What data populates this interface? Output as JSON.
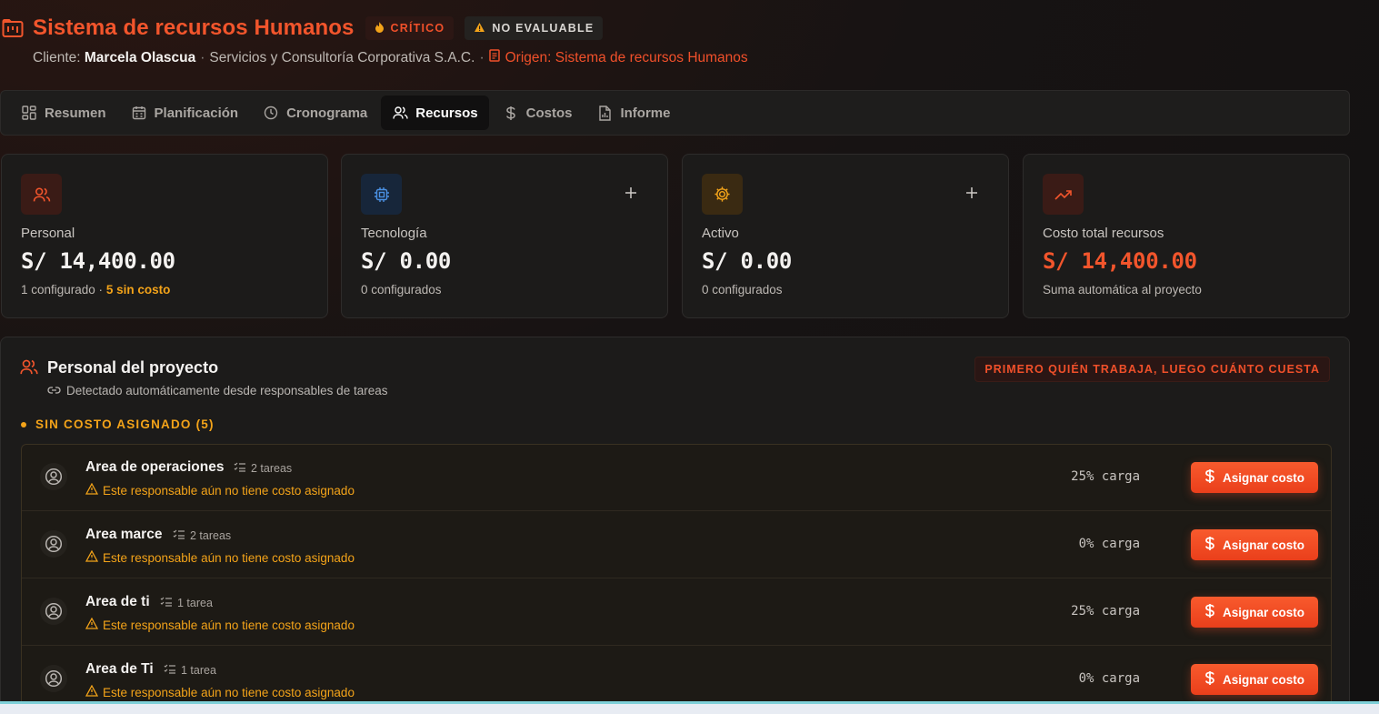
{
  "header": {
    "title": "Sistema de recursos Humanos",
    "badge_critical": "CRÍTICO",
    "badge_noeval": "NO EVALUABLE",
    "client_prefix": "Cliente:",
    "client_name": "Marcela Olascua",
    "company": "Servicios y Consultoría Corporativa S.A.C.",
    "origin": "Origen: Sistema de recursos Humanos"
  },
  "tabs": [
    {
      "label": "Resumen",
      "icon": "grid-icon"
    },
    {
      "label": "Planificación",
      "icon": "calendar-icon"
    },
    {
      "label": "Cronograma",
      "icon": "clock-icon"
    },
    {
      "label": "Recursos",
      "icon": "users-icon",
      "active": true
    },
    {
      "label": "Costos",
      "icon": "dollar-icon"
    },
    {
      "label": "Informe",
      "icon": "report-icon"
    }
  ],
  "cards": [
    {
      "label": "Personal",
      "value": "S/ 14,400.00",
      "note": "1 configurado ·",
      "note_warn": "5 sin costo",
      "icon": "users-icon"
    },
    {
      "label": "Tecnología",
      "value": "S/ 0.00",
      "note": "0 configurados",
      "icon": "chip-icon"
    },
    {
      "label": "Activo",
      "value": "S/ 0.00",
      "note": "0 configurados",
      "icon": "gear-icon"
    },
    {
      "label": "Costo total recursos",
      "value": "S/ 14,400.00",
      "note": "Suma automática al proyecto",
      "icon": "trending-up-icon"
    }
  ],
  "panel": {
    "title": "Personal del proyecto",
    "subtitle": "Detectado automáticamente desde responsables de tareas",
    "tag": "PRIMERO QUIÉN TRABAJA, LUEGO CUÁNTO CUESTA",
    "section": "SIN COSTO ASIGNADO (5)",
    "rows": [
      {
        "name": "Area de operaciones",
        "tasks": "2 tareas",
        "warning": "Este responsable aún no tiene costo asignado",
        "load": "25% carga",
        "button": "Asignar costo"
      },
      {
        "name": "Area marce",
        "tasks": "2 tareas",
        "warning": "Este responsable aún no tiene costo asignado",
        "load": "0% carga",
        "button": "Asignar costo"
      },
      {
        "name": "Area de ti",
        "tasks": "1 tarea",
        "warning": "Este responsable aún no tiene costo asignado",
        "load": "25% carga",
        "button": "Asignar costo"
      },
      {
        "name": "Area de Ti",
        "tasks": "1 tarea",
        "warning": "Este responsable aún no tiene costo asignado",
        "load": "0% carga",
        "button": "Asignar costo"
      }
    ]
  },
  "colors": {
    "accent": "#f2552c",
    "warning": "#f3a319",
    "background": "#141212"
  }
}
